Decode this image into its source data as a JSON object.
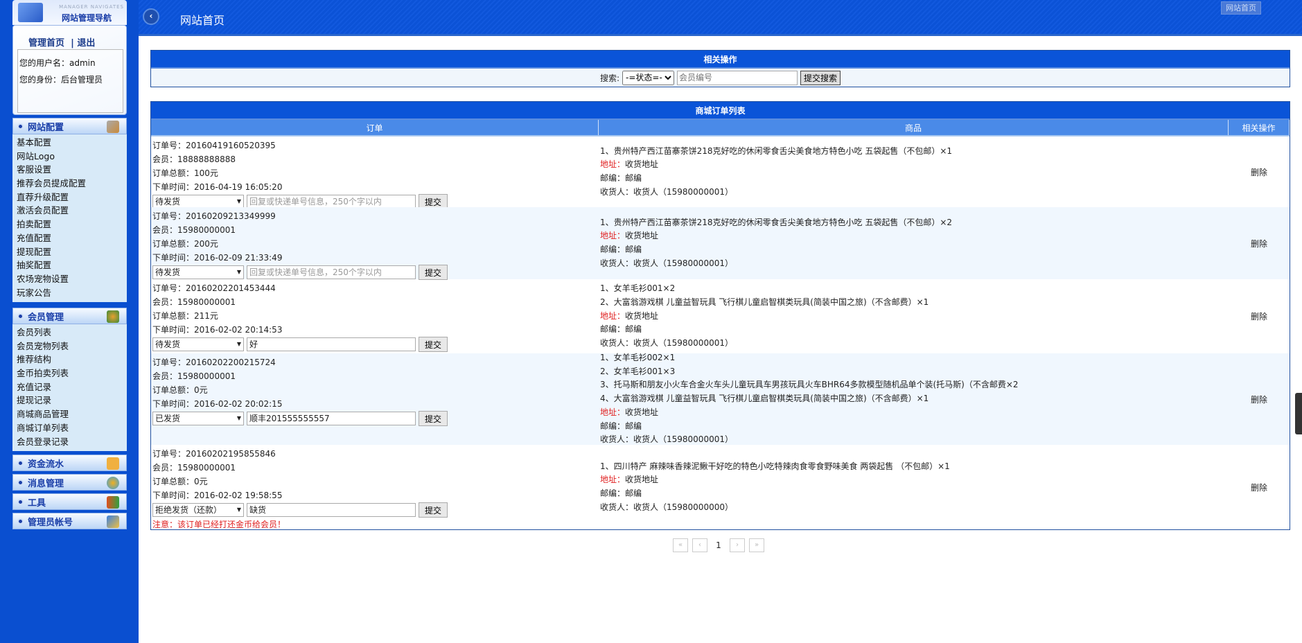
{
  "sidebar": {
    "logo_en": "MANAGER NAVIGATES",
    "logo_cn": "网站管理导航",
    "home_link": "管理首页",
    "logout_link": "退出",
    "username": "您的用户名：admin",
    "role": "您的身份：后台管理员",
    "sections": [
      {
        "title": "网站配置",
        "icon": "tools-icon",
        "items": [
          "基本配置",
          "网站Logo",
          "客服设置",
          "推荐会员提成配置",
          "直荐升级配置",
          "激活会员配置",
          "拍卖配置",
          "充值配置",
          "提现配置",
          "抽奖配置",
          "农场宠物设置",
          "玩家公告"
        ]
      },
      {
        "title": "会员管理",
        "icon": "users-icon",
        "items": [
          "会员列表",
          "会员宠物列表",
          "推荐结构",
          "金币拍卖列表",
          "充值记录",
          "提现记录",
          "商城商品管理",
          "商城订单列表",
          "会员登录记录"
        ]
      },
      {
        "title": "资金流水",
        "icon": "lock-icon"
      },
      {
        "title": "消息管理",
        "icon": "gears-icon"
      },
      {
        "title": "工具",
        "icon": "tool-icon"
      },
      {
        "title": "管理员帐号",
        "icon": "edit-icon"
      }
    ]
  },
  "header": {
    "title": "网站首页",
    "top_button": "网站首页"
  },
  "search_panel": {
    "title": "相关操作",
    "label": "搜索:",
    "status_select": "-=状态=-",
    "member_placeholder": "会员编号",
    "submit": "提交搜索"
  },
  "orders_panel": {
    "title": "商城订单列表",
    "columns": [
      "订单",
      "商品",
      "相关操作"
    ],
    "reply_placeholder": "回复或快递单号信息，250个字以内",
    "submit_label": "提交",
    "delete_label": "删除",
    "rows": [
      {
        "order_no": "订单号：20160419160520395",
        "member": "会员：18888888888",
        "total": "订单总额：100元",
        "time": "下单时间：2016-04-19 16:05:20",
        "status": "待发货",
        "reply": "",
        "goods": [
          "1、贵州特产西江苗寨茶饼218克好吃的休闲零食舌尖美食地方特色小吃 五袋起售（不包邮）×1"
        ],
        "address_label": "地址：",
        "address": "收货地址",
        "zip": "邮编：邮编",
        "receiver": "收货人：收货人（15980000001）"
      },
      {
        "order_no": "订单号：20160209213349999",
        "member": "会员：15980000001",
        "total": "订单总额：200元",
        "time": "下单时间：2016-02-09 21:33:49",
        "status": "待发货",
        "reply": "",
        "goods": [
          "1、贵州特产西江苗寨茶饼218克好吃的休闲零食舌尖美食地方特色小吃 五袋起售（不包邮）×2"
        ],
        "address_label": "地址：",
        "address": "收货地址",
        "zip": "邮编：邮编",
        "receiver": "收货人：收货人（15980000001）"
      },
      {
        "order_no": "订单号：20160202201453444",
        "member": "会员：15980000001",
        "total": "订单总额：211元",
        "time": "下单时间：2016-02-02 20:14:53",
        "status": "待发货",
        "reply": "好",
        "goods": [
          "1、女羊毛衫001×2",
          "2、大富翁游戏棋 儿童益智玩具 飞行棋儿童启智棋类玩具(简装中国之旅)（不含邮费）×1"
        ],
        "address_label": "地址：",
        "address": "收货地址",
        "zip": "邮编：邮编",
        "receiver": "收货人：收货人（15980000001）"
      },
      {
        "order_no": "订单号：20160202200215724",
        "member": "会员：15980000001",
        "total": "订单总额：0元",
        "time": "下单时间：2016-02-02 20:02:15",
        "status": "已发货",
        "reply": "顺丰201555555557",
        "goods": [
          "1、女羊毛衫002×1",
          "2、女羊毛衫001×3",
          "3、托马斯和朋友小火车合金火车头儿童玩具车男孩玩具火车BHR64多款模型随机品单个装(托马斯)（不含邮费×2",
          "4、大富翁游戏棋 儿童益智玩具 飞行棋儿童启智棋类玩具(简装中国之旅)（不含邮费）×1"
        ],
        "address_label": "地址：",
        "address": "收货地址",
        "zip": "邮编：邮编",
        "receiver": "收货人：收货人（15980000001）"
      },
      {
        "order_no": "订单号：20160202195855846",
        "member": "会员：15980000001",
        "total": "订单总额：0元",
        "time": "下单时间：2016-02-02 19:58:55",
        "status": "拒绝发货（还款）",
        "reply": "缺货",
        "note": "注意：该订单已经打还金币给会员！",
        "goods": [
          "1、四川特产 麻辣味香辣泥鳅干好吃的特色小吃特辣肉食零食野味美食 两袋起售 （不包邮）×1"
        ],
        "address_label": "地址：",
        "address": "收货地址",
        "zip": "邮编：邮编",
        "receiver": "收货人：收货人（15980000000）"
      }
    ]
  },
  "pagination": {
    "first": "«",
    "prev": "‹",
    "current": "1",
    "next": "›",
    "last": "»"
  },
  "colors": {
    "brand": "#0a54d8",
    "sidebar": "#0a4fd0",
    "warning": "#e02020"
  }
}
